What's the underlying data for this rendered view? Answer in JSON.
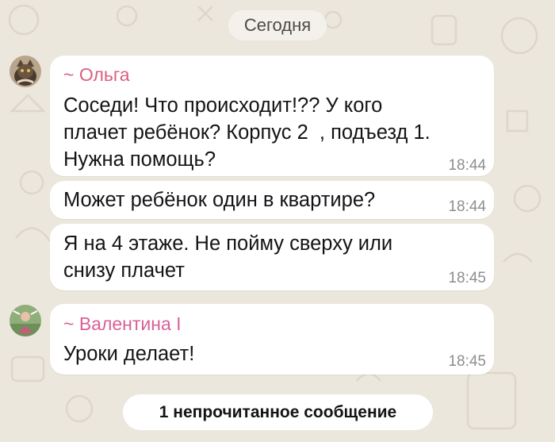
{
  "chat": {
    "date_label": "Сегодня",
    "messages": [
      {
        "sender": "~ Ольга",
        "lines": [
          "Соседи! Что происходит!?? У кого",
          "плачет ребёнок? Корпус 2  , подъезд 1.",
          "Нужна помощь?"
        ],
        "time": "18:44"
      },
      {
        "lines": [
          "Может ребёнок один в квартире?"
        ],
        "time": "18:44"
      },
      {
        "lines": [
          "Я на 4 этаже. Не пойму сверху или",
          "снизу плачет"
        ],
        "time": "18:45"
      },
      {
        "sender": "~ Валентина I",
        "lines": [
          "Уроки делает!"
        ],
        "time": "18:45"
      }
    ],
    "unread_label": "1 непрочитанное сообщение"
  },
  "colors": {
    "background": "#ece7dd",
    "bubble": "#ffffff",
    "sender_olga": "#d9607f",
    "sender_valentina": "#d9609a",
    "time": "#8e8e8e"
  },
  "icons": [
    "olga-avatar",
    "valentina-avatar"
  ]
}
